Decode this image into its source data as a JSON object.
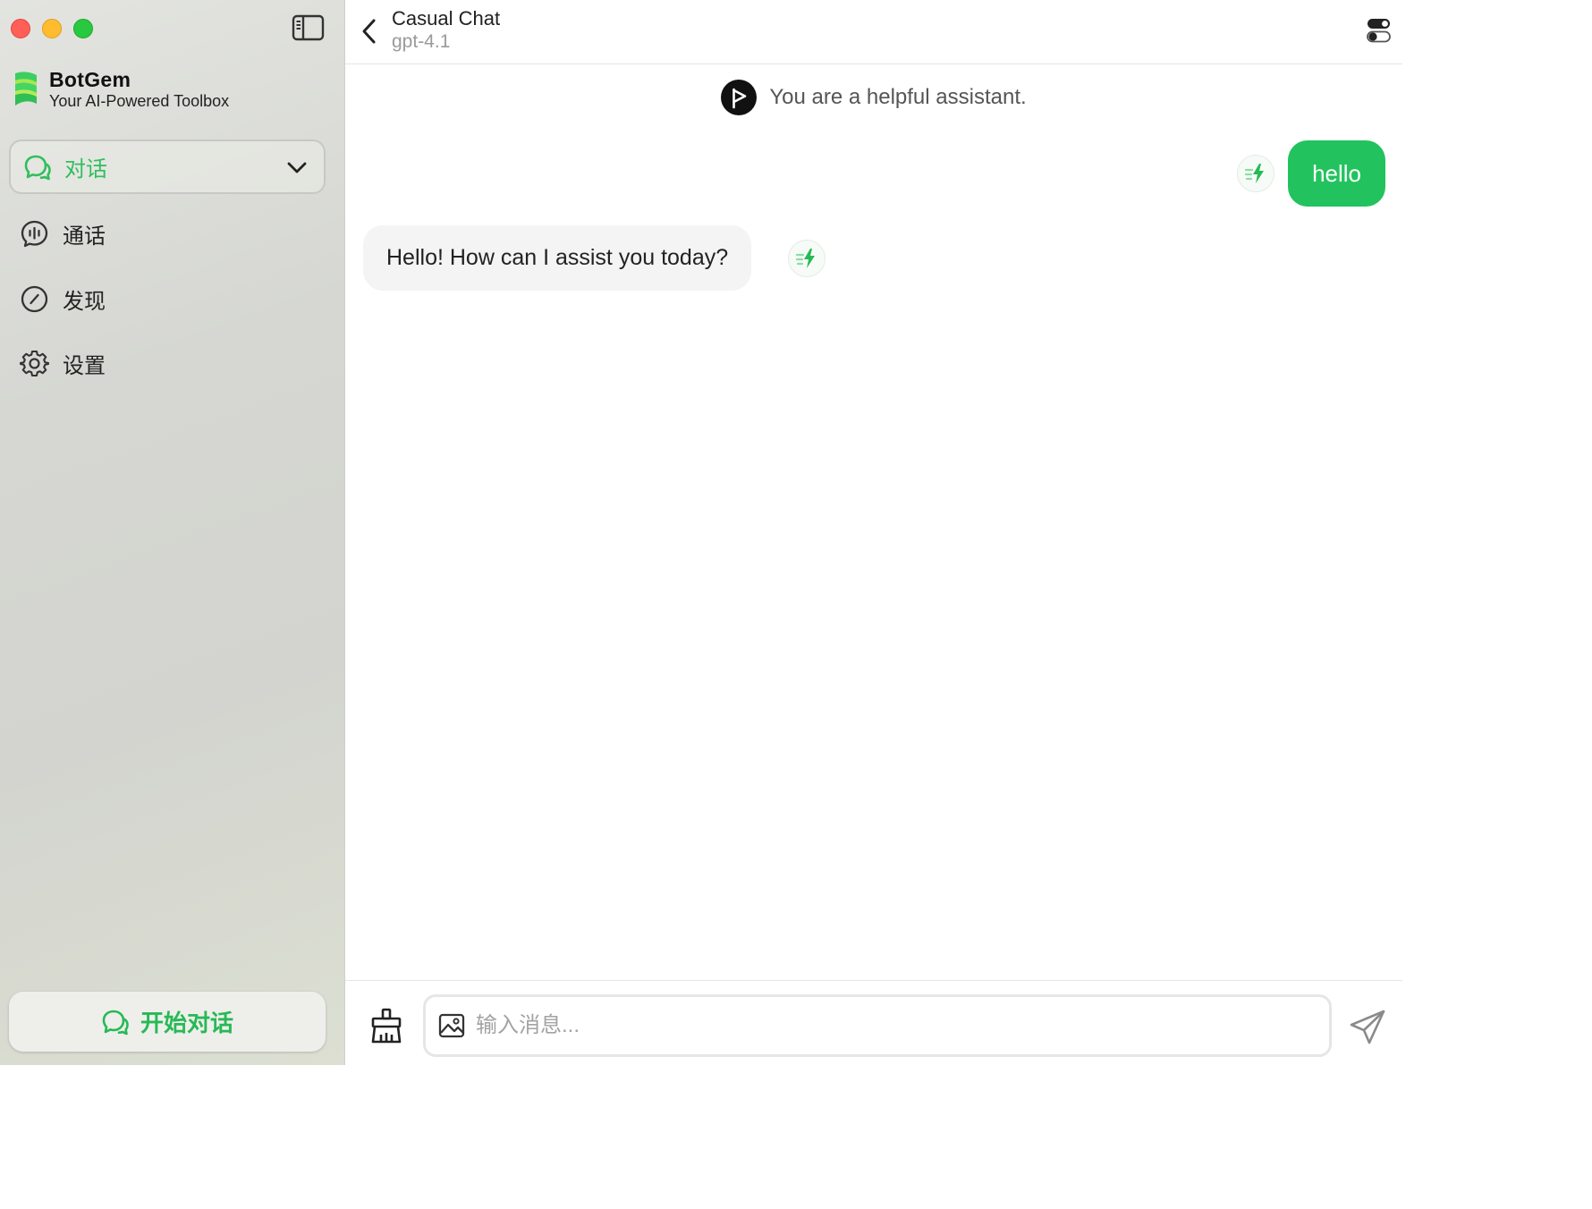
{
  "brand": {
    "name": "BotGem",
    "tagline": "Your AI-Powered Toolbox",
    "accent_color": "#27b955"
  },
  "sidebar": {
    "selected_mode": {
      "label": "对话",
      "icon": "chat-bubble-icon"
    },
    "items": [
      {
        "label": "通话",
        "icon": "voice-call-icon"
      },
      {
        "label": "发现",
        "icon": "compass-icon"
      },
      {
        "label": "设置",
        "icon": "gear-icon"
      }
    ],
    "new_chat_label": "开始对话"
  },
  "chat": {
    "title": "Casual Chat",
    "model": "gpt-4.1",
    "system_prompt": "You are a helpful assistant.",
    "messages": [
      {
        "role": "user",
        "text": "hello"
      },
      {
        "role": "assistant",
        "text": "Hello! How can I assist you today?"
      }
    ]
  },
  "input": {
    "placeholder": "输入消息...",
    "value": ""
  },
  "colors": {
    "user_bubble": "#22c35e",
    "assistant_bubble": "#f4f4f4"
  }
}
